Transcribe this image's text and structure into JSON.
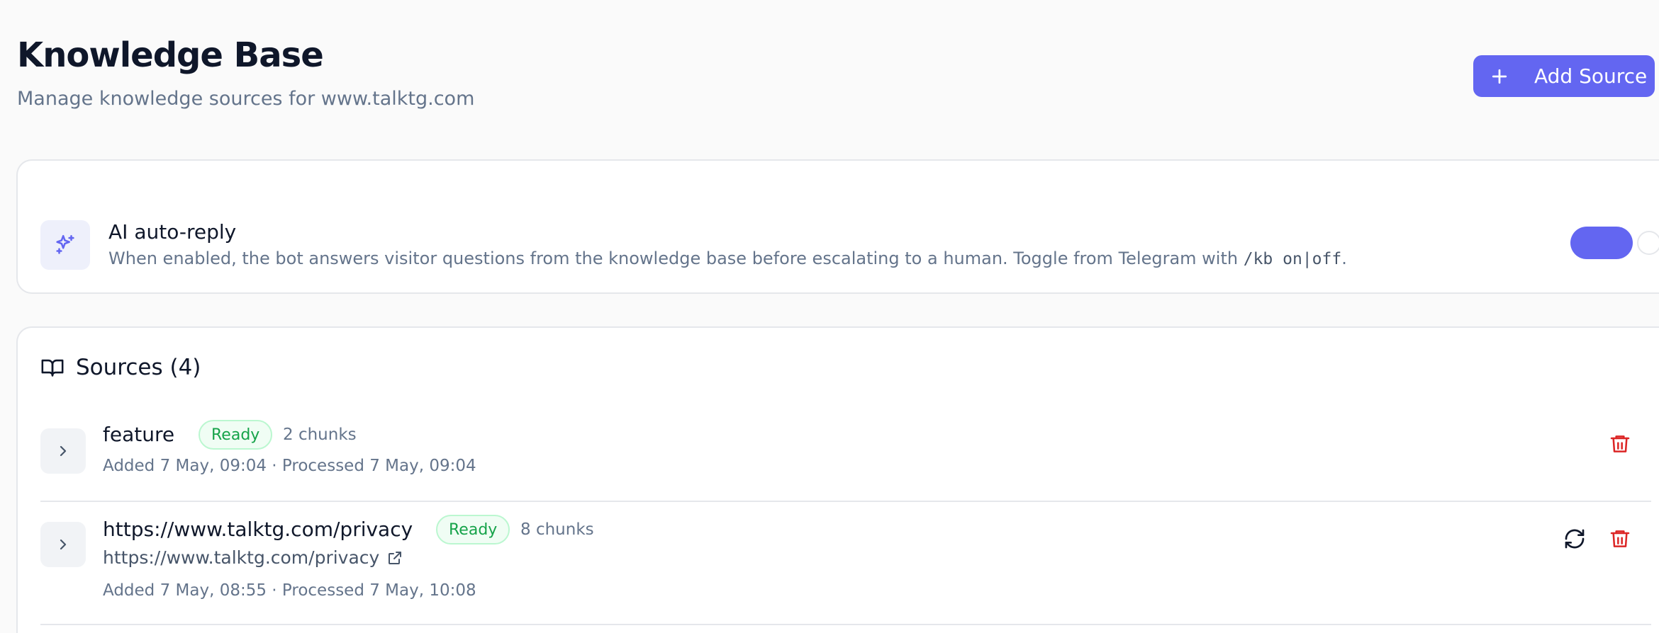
{
  "header": {
    "title": "Knowledge Base",
    "subtitle": "Manage knowledge sources for www.talktg.com",
    "add_button_label": "Add Source"
  },
  "auto_reply": {
    "title": "AI auto-reply",
    "description_prefix": "When enabled, the bot answers visitor questions from the knowledge base before escalating to a human. Toggle from Telegram with ",
    "command": "/kb on|off",
    "description_suffix": ".",
    "enabled": true
  },
  "sources": {
    "title": "Sources (4)",
    "items": [
      {
        "title": "feature",
        "status": "Ready",
        "chunks": "2 chunks",
        "meta": "Added 7 May, 09:04 · Processed 7 May, 09:04"
      },
      {
        "title": "https://www.talktg.com/privacy",
        "status": "Ready",
        "chunks": "8 chunks",
        "link": "https://www.talktg.com/privacy",
        "meta": "Added 7 May, 08:55 · Processed 7 May, 10:08"
      }
    ]
  },
  "colors": {
    "accent": "#6366f1",
    "ready_text": "#16a34a",
    "danger": "#dc2626"
  }
}
